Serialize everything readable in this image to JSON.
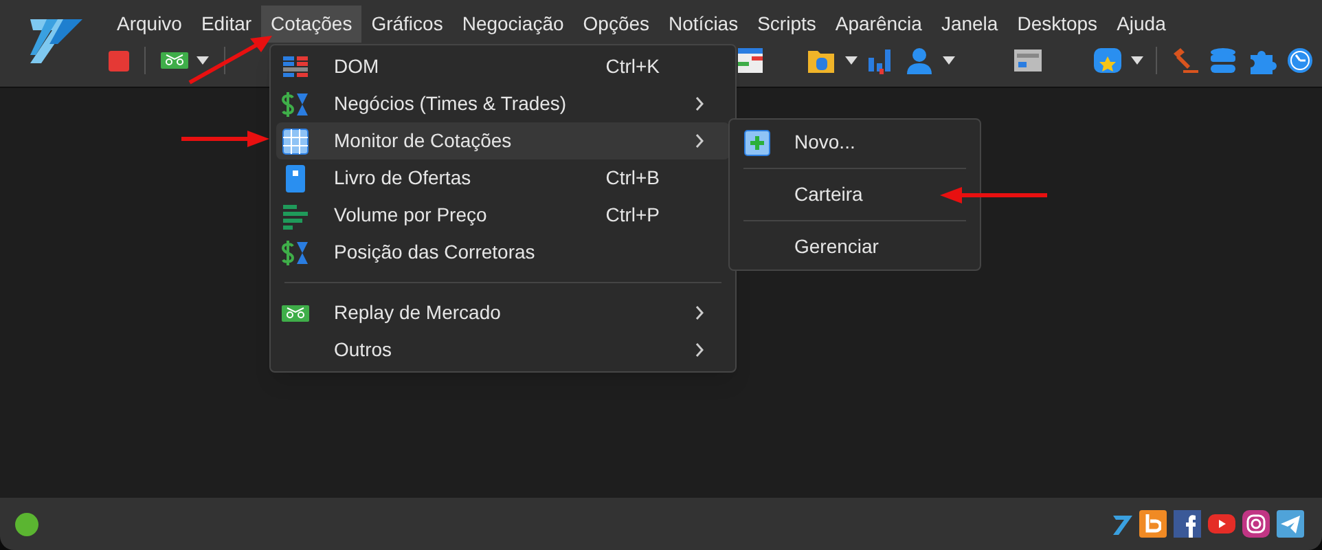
{
  "menubar": [
    {
      "label": "Arquivo",
      "selected": false
    },
    {
      "label": "Editar",
      "selected": false
    },
    {
      "label": "Cotações",
      "selected": true
    },
    {
      "label": "Gráficos",
      "selected": false
    },
    {
      "label": "Negociação",
      "selected": false
    },
    {
      "label": "Opções",
      "selected": false
    },
    {
      "label": "Notícias",
      "selected": false
    },
    {
      "label": "Scripts",
      "selected": false
    },
    {
      "label": "Aparência",
      "selected": false
    },
    {
      "label": "Janela",
      "selected": false
    },
    {
      "label": "Desktops",
      "selected": false
    },
    {
      "label": "Ajuda",
      "selected": false
    }
  ],
  "dropdown": [
    {
      "kind": "item",
      "label": "DOM",
      "shortcut": "Ctrl+K",
      "submenu": false,
      "selected": false
    },
    {
      "kind": "item",
      "label": "Negócios (Times & Trades)",
      "submenu": true,
      "selected": false
    },
    {
      "kind": "item",
      "label": "Monitor de Cotações",
      "submenu": true,
      "selected": true
    },
    {
      "kind": "item",
      "label": "Livro de Ofertas",
      "shortcut": "Ctrl+B",
      "submenu": false,
      "selected": false
    },
    {
      "kind": "item",
      "label": "Volume por Preço",
      "shortcut": "Ctrl+P",
      "submenu": false,
      "selected": false
    },
    {
      "kind": "item",
      "label": "Posição das Corretoras",
      "submenu": false,
      "selected": false
    },
    {
      "kind": "separator"
    },
    {
      "kind": "item",
      "label": "Replay de Mercado",
      "submenu": true,
      "selected": false
    },
    {
      "kind": "item",
      "label": "Outros",
      "submenu": true,
      "selected": false
    }
  ],
  "submenu": [
    {
      "kind": "item",
      "label": "Novo..."
    },
    {
      "kind": "separator"
    },
    {
      "kind": "item",
      "label": "Carteira"
    },
    {
      "kind": "separator"
    },
    {
      "kind": "item",
      "label": "Gerenciar"
    }
  ]
}
